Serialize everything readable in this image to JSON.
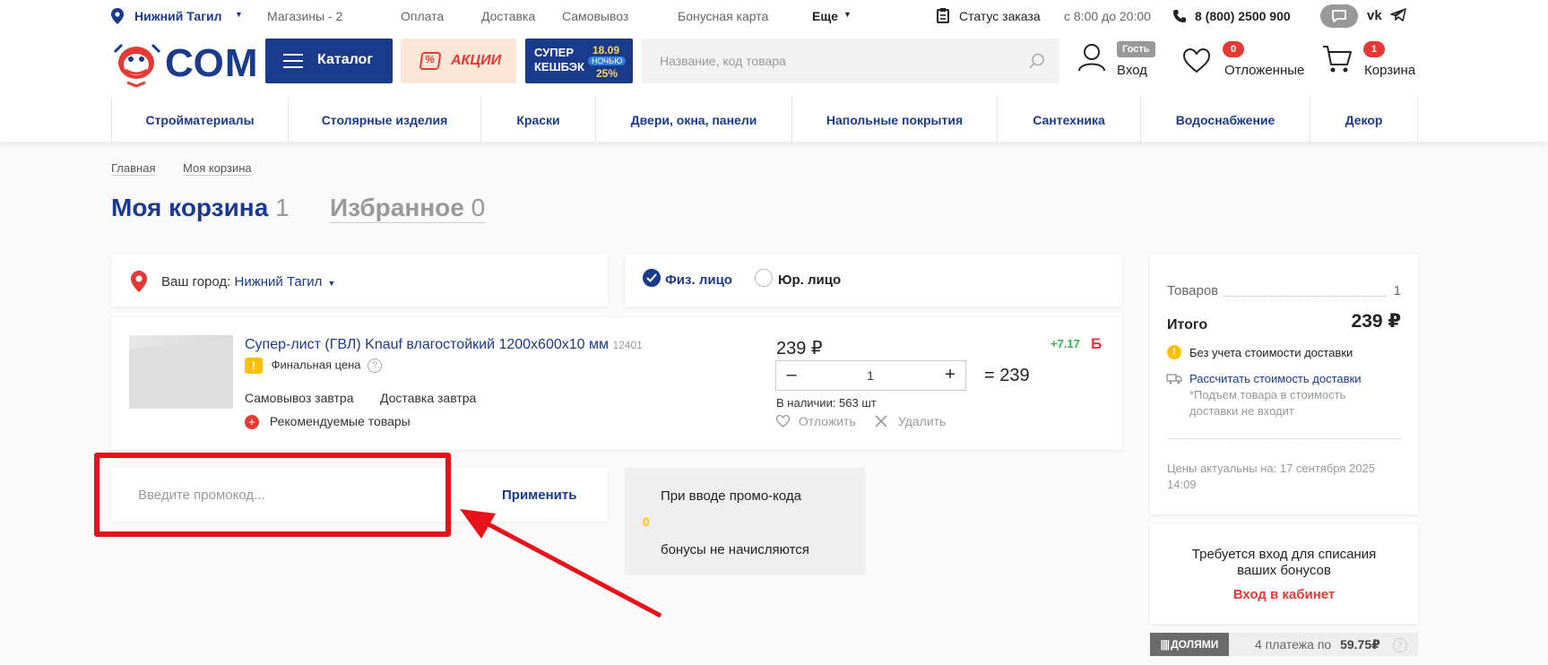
{
  "topbar": {
    "city": "Нижний Тагил",
    "stores": "Магазины - 2",
    "links": [
      "Оплата",
      "Доставка",
      "Самовывоз",
      "Бонусная карта"
    ],
    "more": "Еще",
    "order_status": "Статус заказа",
    "hours": "с 8:00 до 20:00",
    "phone": "8 (800) 2500 900"
  },
  "header": {
    "logo_text": "СОМ",
    "catalog_label": "Каталог",
    "promo_label": "АКЦИИ",
    "cashback": {
      "line1": "СУПЕР",
      "line2": "КЕШБЭК",
      "date": "18.09",
      "tag": "НОЧЬЮ",
      "percent": "25%"
    },
    "search_placeholder": "Название, код товара",
    "login_badge": "Гость",
    "login_label": "Вход",
    "wishlist_count": "0",
    "wishlist_label": "Отложенные",
    "cart_count": "1",
    "cart_label": "Корзина"
  },
  "nav": [
    "Стройматериалы",
    "Столярные изделия",
    "Краски",
    "Двери, окна, панели",
    "Напольные покрытия",
    "Сантехника",
    "Водоснабжение",
    "Декор"
  ],
  "breadcrumbs": [
    "Главная",
    "Моя корзина"
  ],
  "tabs": {
    "cart_label": "Моя корзина",
    "cart_count": "1",
    "fav_label": "Избранное",
    "fav_count": "0"
  },
  "city_box": {
    "label": "Ваш город:",
    "value": "Нижний Тагил"
  },
  "customer_type": {
    "individual": "Физ. лицо",
    "company": "Юр. лицо",
    "selected": "individual"
  },
  "product": {
    "title": "Супер-лист (ГВЛ) Knauf влагостойкий 1200х600х10 мм",
    "sku": "12401",
    "final_price": "Финальная цена",
    "pickup": "Самовывоз завтра",
    "delivery": "Доставка завтра",
    "recommended": "Рекомендуемые товары",
    "price": "239 ₽",
    "quantity": "1",
    "total": "= 239",
    "stock": "В наличии: 563 шт",
    "postpone": "Отложить",
    "remove": "Удалить",
    "bonus": "+7.17"
  },
  "promo": {
    "placeholder": "Введите промокод...",
    "apply": "Применить",
    "note_line1": "При вводе промо-кода",
    "note_zero": "0",
    "note_line2": "бонусы не начисляются"
  },
  "summary": {
    "items_label": "Товаров",
    "items_count": "1",
    "total_label": "Итого",
    "total_value": "239 ₽",
    "delivery_note": "Без учета стоимости доставки",
    "calc_delivery": "Рассчитать стоимость доставки",
    "lift_note_1": "*Подъем товара в стоимость",
    "lift_note_2": "доставки не входит",
    "prices_actual_1": "Цены актуальны на: 17 сентября 2025",
    "prices_actual_2": "14:09"
  },
  "bonus_login": {
    "line1": "Требуется вход для списания",
    "line2": "ваших бонусов",
    "link": "Вход в кабинет"
  },
  "dolyami": {
    "logo": "ДОЛЯМИ",
    "text_prefix": "4 платежа по",
    "amount": "59.75₽"
  },
  "colors": {
    "brand": "#1a3a8c",
    "accent_red": "#e53935",
    "highlight": "#e8121a"
  }
}
